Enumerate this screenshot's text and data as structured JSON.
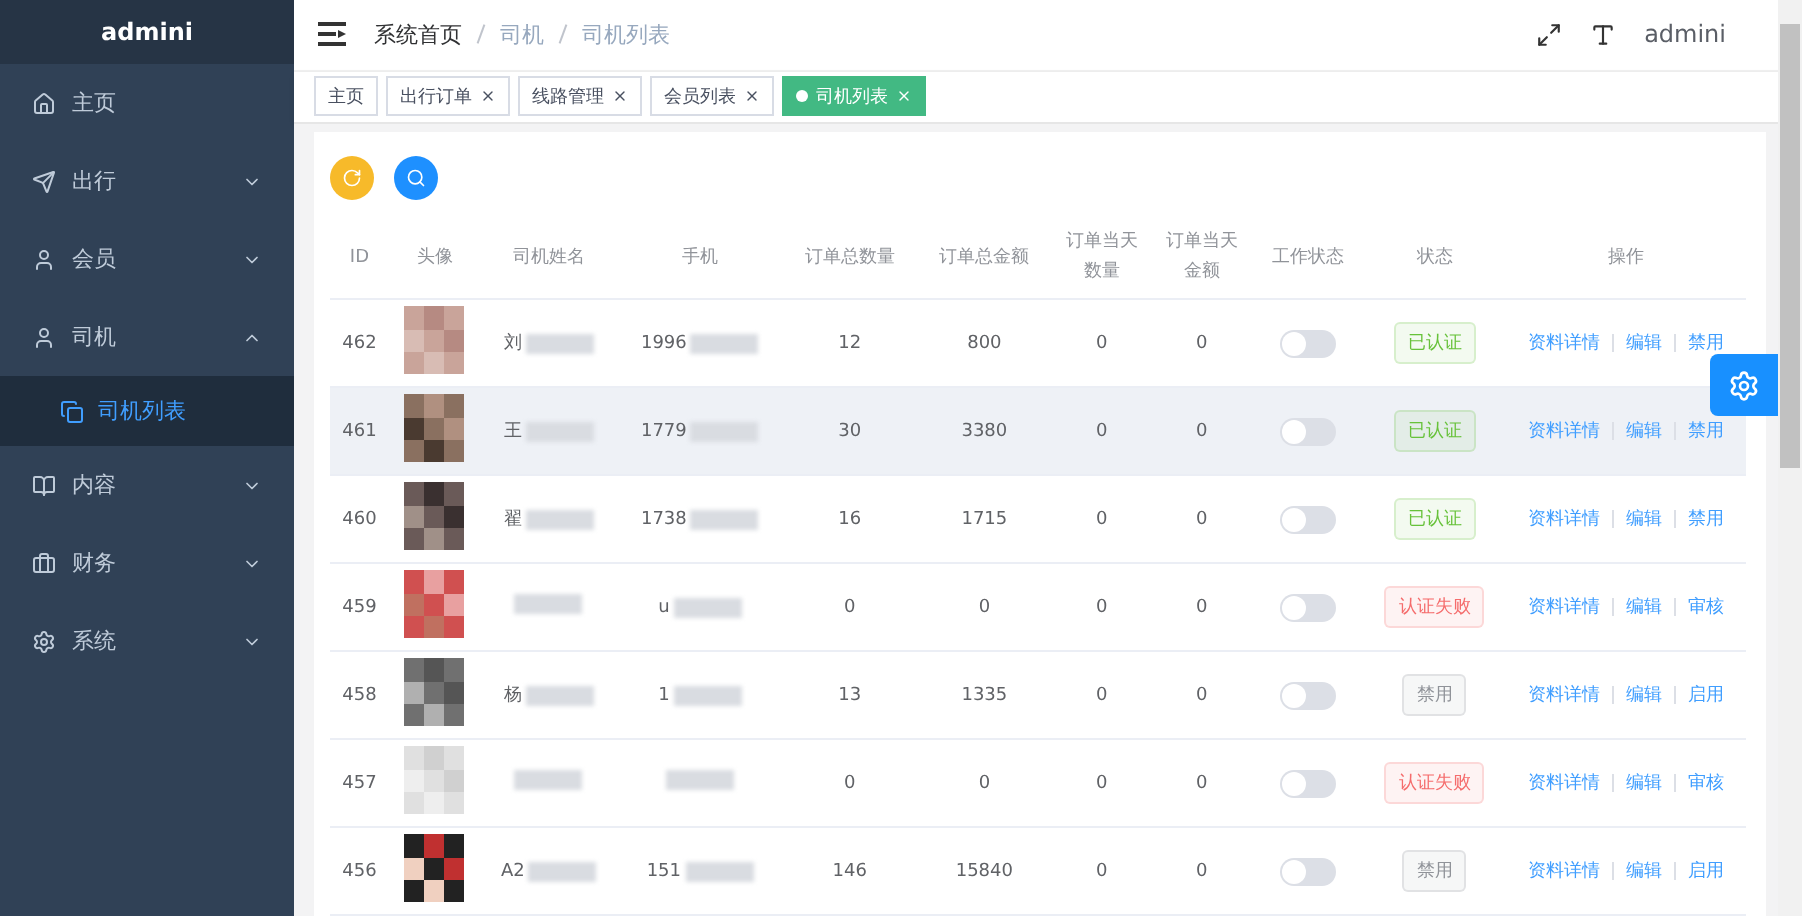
{
  "sidebar": {
    "brand": "admini",
    "items": [
      {
        "label": "主页",
        "kind": "link"
      },
      {
        "label": "出行",
        "kind": "group",
        "expanded": false
      },
      {
        "label": "会员",
        "kind": "group",
        "expanded": false
      },
      {
        "label": "司机",
        "kind": "group",
        "expanded": true,
        "children": [
          {
            "label": "司机列表",
            "selected": true
          }
        ]
      },
      {
        "label": "内容",
        "kind": "group",
        "expanded": false
      },
      {
        "label": "财务",
        "kind": "group",
        "expanded": false
      },
      {
        "label": "系统",
        "kind": "group",
        "expanded": false
      }
    ]
  },
  "header": {
    "breadcrumb": [
      "系统首页",
      "司机",
      "司机列表"
    ],
    "user": "admini"
  },
  "tags": [
    {
      "label": "主页",
      "selected": false,
      "kind": "fixed"
    },
    {
      "label": "出行订单",
      "selected": false,
      "kind": "closable"
    },
    {
      "label": "线路管理",
      "selected": false,
      "kind": "closable"
    },
    {
      "label": "会员列表",
      "selected": false,
      "kind": "closable"
    },
    {
      "label": "司机列表",
      "selected": true,
      "kind": "closable"
    }
  ],
  "table": {
    "columns": [
      "ID",
      "头像",
      "司机姓名",
      "手机",
      "订单总数量",
      "订单总金额",
      "订单当天数量",
      "订单当天金额",
      "工作状态",
      "状态",
      "操作"
    ],
    "rows": [
      {
        "id": "462",
        "name": "刘",
        "phone": "1996",
        "orders": "12",
        "amount": "800",
        "today_orders": "0",
        "today_amount": "0",
        "working": false,
        "status": {
          "label": "已认证",
          "color": "#67c23a"
        },
        "actions": [
          "资料详情",
          "编辑",
          "禁用"
        ],
        "highlighted": false
      },
      {
        "id": "461",
        "name": "王",
        "phone": "1779",
        "orders": "30",
        "amount": "3380",
        "today_orders": "0",
        "today_amount": "0",
        "working": false,
        "status": {
          "label": "已认证",
          "color": "#67c23a"
        },
        "actions": [
          "资料详情",
          "编辑",
          "禁用"
        ],
        "highlighted": true
      },
      {
        "id": "460",
        "name": "翟",
        "phone": "1738",
        "orders": "16",
        "amount": "1715",
        "today_orders": "0",
        "today_amount": "0",
        "working": false,
        "status": {
          "label": "已认证",
          "color": "#67c23a"
        },
        "actions": [
          "资料详情",
          "编辑",
          "禁用"
        ],
        "highlighted": false
      },
      {
        "id": "459",
        "name": "",
        "phone": "u",
        "orders": "0",
        "amount": "0",
        "today_orders": "0",
        "today_amount": "0",
        "working": false,
        "status": {
          "label": "认证失败",
          "color": "#f56c6c"
        },
        "actions": [
          "资料详情",
          "编辑",
          "审核"
        ],
        "highlighted": false
      },
      {
        "id": "458",
        "name": "杨",
        "phone": "1",
        "orders": "13",
        "amount": "1335",
        "today_orders": "0",
        "today_amount": "0",
        "working": false,
        "status": {
          "label": "禁用",
          "color": "#909399"
        },
        "actions": [
          "资料详情",
          "编辑",
          "启用"
        ],
        "highlighted": false
      },
      {
        "id": "457",
        "name": "",
        "phone": "",
        "orders": "0",
        "amount": "0",
        "today_orders": "0",
        "today_amount": "0",
        "working": false,
        "status": {
          "label": "认证失败",
          "color": "#f56c6c"
        },
        "actions": [
          "资料详情",
          "编辑",
          "审核"
        ],
        "highlighted": false
      },
      {
        "id": "456",
        "name": "A2",
        "phone": "151",
        "orders": "146",
        "amount": "15840",
        "today_orders": "0",
        "today_amount": "0",
        "working": false,
        "status": {
          "label": "禁用",
          "color": "#909399"
        },
        "actions": [
          "资料详情",
          "编辑",
          "启用"
        ],
        "highlighted": false
      }
    ]
  }
}
